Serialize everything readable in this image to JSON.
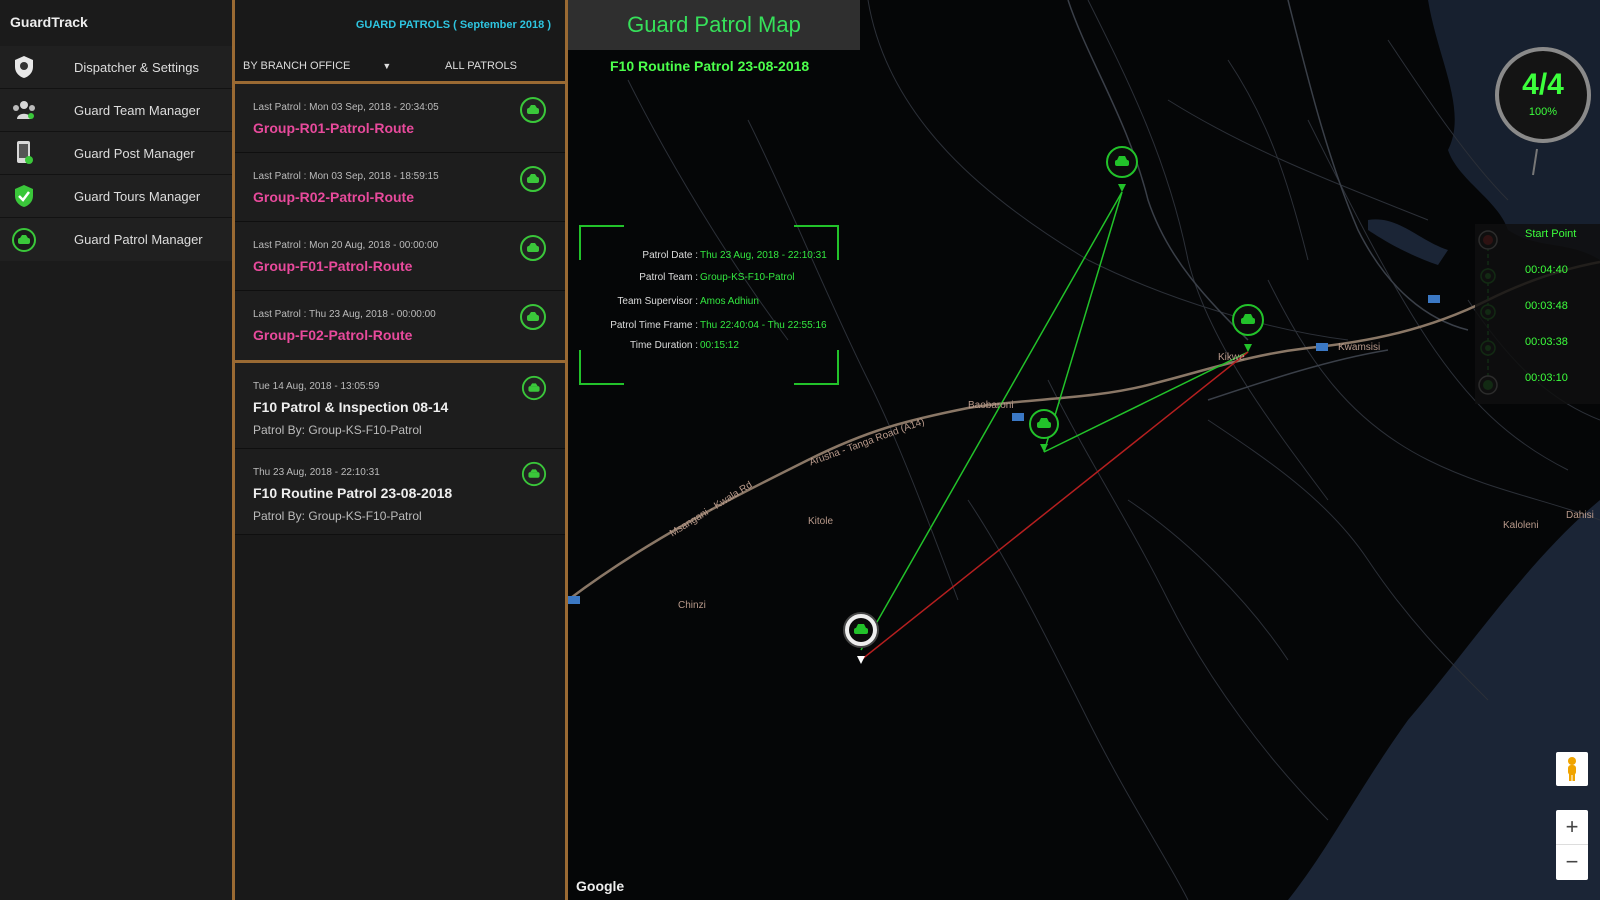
{
  "sidebar": {
    "brand": "GuardTrack",
    "items": [
      {
        "label": "Dispatcher & Settings",
        "icon": "shield-icon"
      },
      {
        "label": "Guard Team Manager",
        "icon": "team-icon"
      },
      {
        "label": "Guard Post Manager",
        "icon": "phone-icon"
      },
      {
        "label": "Guard Tours Manager",
        "icon": "shield-check-icon"
      },
      {
        "label": "Guard Patrol Manager",
        "icon": "patrol-car-icon"
      }
    ]
  },
  "panel": {
    "title": "GUARD PATROLS ( September 2018 )",
    "branch_filter": "BY BRANCH OFFICE",
    "all_patrols": "ALL PATROLS",
    "routes": [
      {
        "sub": "Last Patrol : Mon 03 Sep, 2018 - 20:34:05",
        "name": "Group-R01-Patrol-Route"
      },
      {
        "sub": "Last Patrol : Mon 03 Sep, 2018 - 18:59:15",
        "name": "Group-R02-Patrol-Route"
      },
      {
        "sub": "Last Patrol : Mon 20 Aug, 2018 - 00:00:00",
        "name": "Group-F01-Patrol-Route"
      },
      {
        "sub": "Last Patrol : Thu 23 Aug, 2018 - 00:00:00",
        "name": "Group-F02-Patrol-Route"
      }
    ],
    "history": [
      {
        "date": "Tue 14 Aug, 2018 - 13:05:59",
        "name": "F10 Patrol & Inspection 08-14",
        "by": "Patrol By: Group-KS-F10-Patrol"
      },
      {
        "date": "Thu 23 Aug, 2018 - 22:10:31",
        "name": "F10 Routine Patrol 23-08-2018",
        "by": "Patrol By: Group-KS-F10-Patrol"
      }
    ]
  },
  "map": {
    "title": "Guard Patrol Map",
    "subtitle": "F10 Routine Patrol 23-08-2018",
    "info": [
      {
        "key": "Patrol Date :",
        "value": "Thu 23 Aug, 2018 - 22:10:31"
      },
      {
        "key": "Patrol Team :",
        "value": "Group-KS-F10-Patrol"
      },
      {
        "key": "Team Supervisor :",
        "value": "Amos Adhiun"
      },
      {
        "key": "Patrol Time Frame :",
        "value": "Thu 22:40:04 - Thu 22:55:16"
      },
      {
        "key": "Time Duration :",
        "value": "00:15:12"
      }
    ],
    "gauge": {
      "value": "4/4",
      "percent": "100%",
      "fraction": 1.0
    },
    "timeline": [
      {
        "label": "Start Point",
        "status": "start"
      },
      {
        "label": "00:04:40",
        "status": "done"
      },
      {
        "label": "00:03:48",
        "status": "done"
      },
      {
        "label": "00:03:38",
        "status": "done"
      },
      {
        "label": "00:03:10",
        "status": "done"
      }
    ],
    "places": {
      "p1": "Baobaroni",
      "p2": "Kikwe",
      "p3": "Kitole",
      "p4": "Chinzi",
      "p5": "Kwamsisi",
      "p6": "Kaloleni",
      "p7": "Dahisi",
      "road1": "Arusha - Tanga Road (A14)",
      "road2": "Msangani - Kwala Rd"
    },
    "attribution": "Google",
    "zoom_in": "+",
    "zoom_out": "−"
  },
  "colors": {
    "accent_green": "#36e05a",
    "route_pink": "#e84a9c",
    "panel_border": "#9a6a33",
    "title_cyan": "#2ec5e0"
  }
}
